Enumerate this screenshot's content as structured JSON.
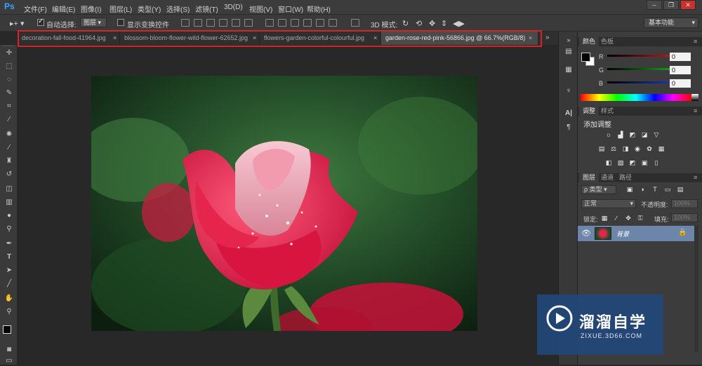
{
  "app": {
    "logo": "Ps"
  },
  "menu": [
    "文件(F)",
    "编辑(E)",
    "图像(I)",
    "图层(L)",
    "类型(Y)",
    "选择(S)",
    "滤镜(T)",
    "3D(D)",
    "视图(V)",
    "窗口(W)",
    "帮助(H)"
  ],
  "window_controls": [
    "minimize",
    "restore",
    "close"
  ],
  "options": {
    "auto_select_label": "自动选择:",
    "auto_select_value": "图层",
    "show_transform_label": "显示变换控件",
    "mode_3d_label": "3D 模式:",
    "workspace": "基本功能"
  },
  "tabs": [
    {
      "label": "decoration-fall-food-41964.jpg",
      "active": false
    },
    {
      "label": "blossom-bloom-flower-wild-flower-62652.jpg",
      "active": false
    },
    {
      "label": "flowers-garden-colorful-colourful.jpg",
      "active": false
    },
    {
      "label": "garden-rose-red-pink-56866.jpg @ 66.7%(RGB/8)",
      "active": true
    }
  ],
  "tools": [
    "move-tool",
    "marquee-tool",
    "lasso-tool",
    "quick-select-tool",
    "crop-tool",
    "eyedropper-tool",
    "healing-brush-tool",
    "brush-tool",
    "clone-stamp-tool",
    "history-brush-tool",
    "eraser-tool",
    "gradient-tool",
    "blur-tool",
    "dodge-tool",
    "pen-tool",
    "type-tool",
    "path-select-tool",
    "line-tool",
    "hand-tool",
    "zoom-tool"
  ],
  "color_panel": {
    "tabs": [
      "颜色",
      "色板"
    ],
    "channels": [
      {
        "label": "R",
        "value": "0",
        "color": "#e02020"
      },
      {
        "label": "G",
        "value": "0",
        "color": "#20c020"
      },
      {
        "label": "B",
        "value": "0",
        "color": "#2040e0"
      }
    ]
  },
  "adjustments_panel": {
    "tabs": [
      "调整",
      "样式"
    ],
    "title": "添加调整"
  },
  "layers_panel": {
    "tabs": [
      "图层",
      "通道",
      "路径"
    ],
    "kind_filter": "ρ 类型",
    "blend_mode": "正常",
    "opacity_label": "不透明度:",
    "opacity_value": "100%",
    "lock_label": "锁定:",
    "fill_label": "填充:",
    "fill_value": "100%",
    "layers": [
      {
        "name": "背景",
        "locked": true
      }
    ]
  },
  "watermark": {
    "brand": "溜溜自学",
    "url": "ZIXUE.3D66.COM"
  },
  "colors": {
    "accent_red": "#d8222a",
    "watermark_bg": "#21477a"
  }
}
